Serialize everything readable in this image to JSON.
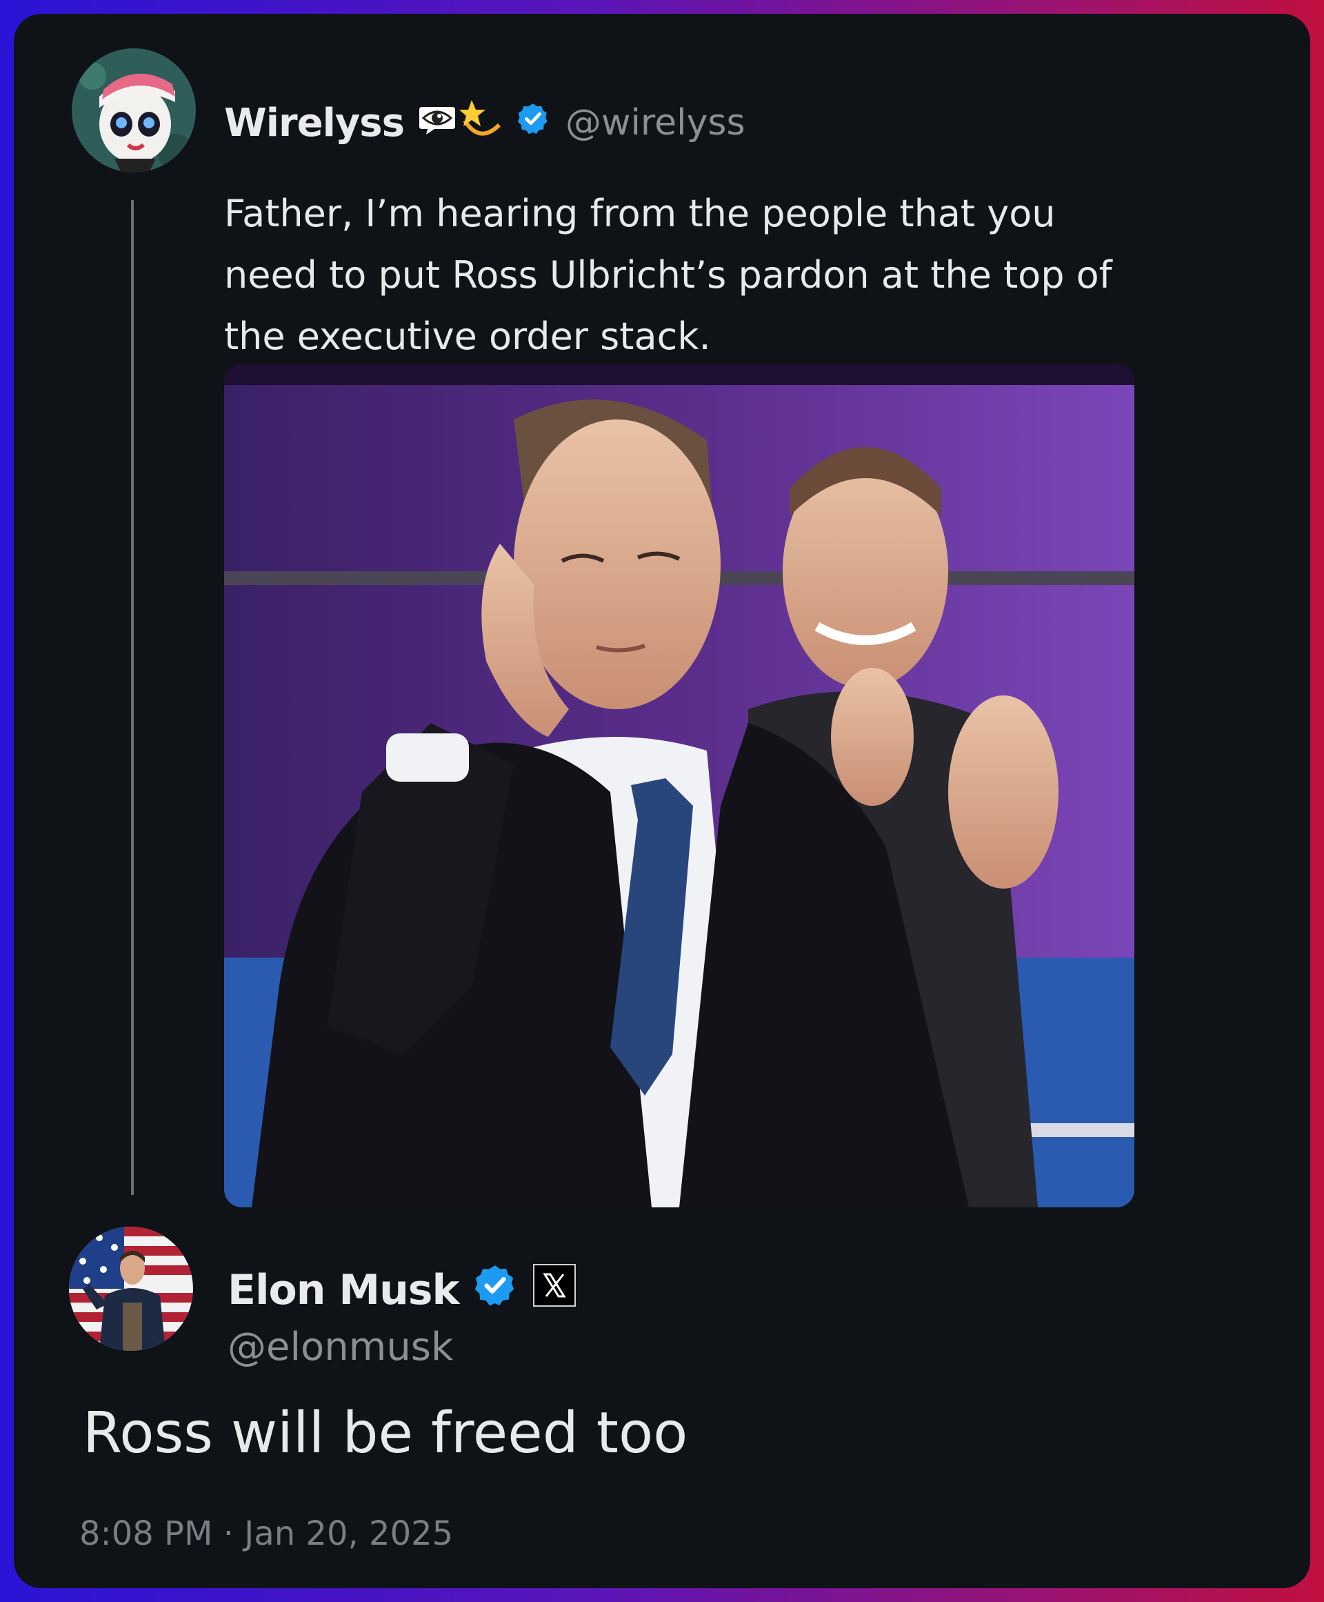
{
  "colors": {
    "background_gradient_start": "#2a14d6",
    "background_gradient_end": "#c0103f",
    "card": "#0f1216",
    "text_primary": "#e7e9ea",
    "text_secondary": "#8b8f94",
    "verified_blue": "#1d9bf0"
  },
  "quoted_tweet": {
    "display_name": "Wirelyss",
    "name_emojis": [
      "eye-in-speech-bubble-icon",
      "dizzy-star-icon"
    ],
    "verified": true,
    "handle": "@wirelyss",
    "text": "Father, I’m hearing from the people that you need to put Ross Ulbricht’s pardon at the top of the executive order stack.",
    "media": "photo of young man in dark suit cupping ear, man clapping behind"
  },
  "reply_tweet": {
    "display_name": "Elon Musk",
    "verified": true,
    "affiliation_badge": "x-logo-icon",
    "handle": "@elonmusk",
    "text": "Ross will be freed too",
    "timestamp": "8:08 PM · Jan 20, 2025"
  }
}
